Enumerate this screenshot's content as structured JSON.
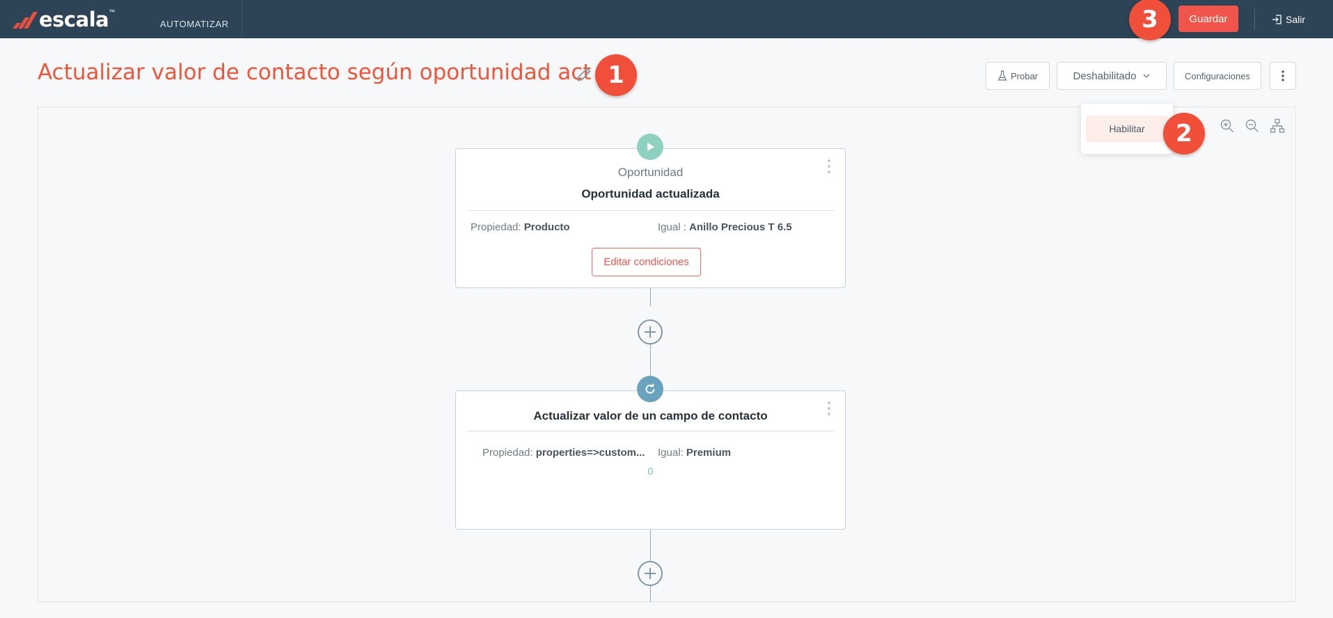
{
  "app": {
    "brand": "escala",
    "brand_tm": "™",
    "nav_item": "AUTOMATIZAR",
    "save_label": "Guardar",
    "exit_label": "Salir"
  },
  "markers": [
    "1",
    "2",
    "3"
  ],
  "header": {
    "title": "Actualizar valor de contacto según oportunidad act",
    "test_label": "Probar",
    "status_label": "Deshabilitado",
    "config_label": "Configuraciones"
  },
  "dropdown": {
    "options": [
      "Habilitar"
    ]
  },
  "trigger_card": {
    "object": "Oportunidad",
    "event": "Oportunidad actualizada",
    "property_key": "Propiedad:",
    "property_value": "Producto",
    "condition_key": "Igual :",
    "condition_value": "Anillo Precious T 6.5",
    "edit_label": "Editar condiciones"
  },
  "action_card": {
    "title": "Actualizar valor de un campo de contacto",
    "property_key": "Propiedad:",
    "property_value": "properties=>custom...",
    "condition_key": "Igual:",
    "condition_value": "Premium",
    "count": "0"
  },
  "colors": {
    "topbar": "#2c4456",
    "accent": "#f0554b",
    "trigger_icon": "#8ed1c0",
    "action_icon": "#6aa3bd"
  }
}
